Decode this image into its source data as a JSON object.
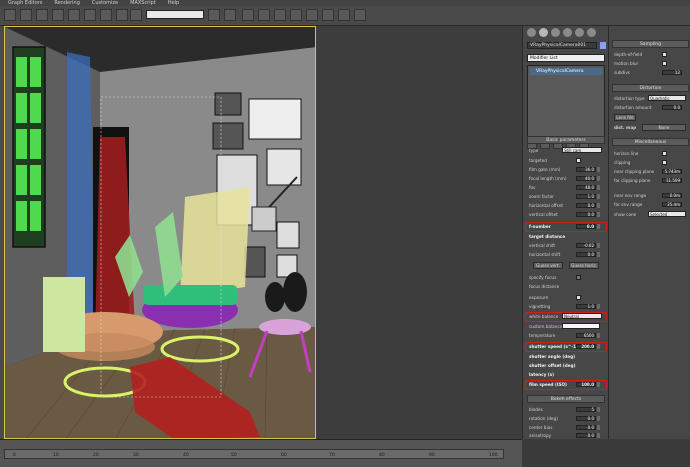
{
  "menu": [
    "Graph Editors",
    "Rendering",
    "Customize",
    "MAXScript",
    "Help"
  ],
  "toolbar": {
    "view_dropdown": ""
  },
  "command_panel": {
    "object_name": "VRayPhysicalCamera001",
    "modifier_list": "Modifier List",
    "stack_item": "VRayPhysicalCamera",
    "basic_parameters": {
      "title": "Basic parameters",
      "type_label": "type",
      "type_value": "Still cam",
      "targeted_label": "targeted",
      "film_gate_label": "film gate (mm)",
      "film_gate": "36.0",
      "focal_length_label": "focal length (mm)",
      "focal_length": "40.0",
      "fov_label": "fov",
      "fov": "48.0",
      "zoom_factor_label": "zoom factor",
      "zoom_factor": "1.0",
      "horizontal_offset_label": "horizontal offset",
      "horizontal_offset": "0.0",
      "vertical_offset_label": "vertical offset",
      "vertical_offset": "0.0",
      "fnumber_label": "f-number",
      "fnumber": "8.0",
      "target_distance_label": "target distance",
      "vertical_shift_label": "vertical shift",
      "vertical_shift": "-0.02",
      "horizontal_shift_label": "horizontal shift",
      "horizontal_shift": "0.0",
      "guess_vert": "Guess vert.",
      "guess_horiz": "Guess horiz.",
      "specify_focus_label": "specify focus",
      "focus_distance_label": "focus distance",
      "exposure_label": "exposure",
      "vignetting_label": "vignetting",
      "vignetting": "1.0",
      "white_balance_label": "white balance",
      "white_balance": "Neutral",
      "custom_balance_label": "custom balance",
      "temperature_label": "temperature",
      "temperature": "6500",
      "shutter_speed_label": "shutter speed (s^-1)",
      "shutter_speed": "200.0",
      "shutter_angle_label": "shutter angle (deg)",
      "shutter_angle": "180.0",
      "shutter_offset_label": "shutter offset (deg)",
      "shutter_offset": "0.0",
      "latency_label": "latency (s)",
      "latency": "0.0",
      "film_speed_label": "film speed (ISO)",
      "film_speed": "100.0"
    },
    "bokeh": {
      "title": "Bokeh effects",
      "blades_label": "blades",
      "blades": "5",
      "rotation_label": "rotation (deg)",
      "rotation": "0.0",
      "center_bias_label": "center bias",
      "center_bias": "0.0",
      "anisotropy_label": "anisotropy",
      "anisotropy": "0.0"
    }
  },
  "right_panel": {
    "sampling": {
      "title": "Sampling",
      "dof_label": "depth-of-field",
      "motion_blur_label": "motion blur",
      "subdivs_label": "subdivs",
      "subdivs": "12"
    },
    "distortion": {
      "title": "Distortion",
      "type_label": "distortion type",
      "type_value": "Quadratic",
      "amount_label": "distortion amount",
      "amount": "0.0",
      "lens_file": "Lens file",
      "dist_map_label": "dist. map",
      "dist_map_value": "None"
    },
    "misc": {
      "title": "Miscellaneous",
      "horizon_label": "horizon line",
      "clipping_label": "clipping",
      "near_clip_label": "near clipping plane",
      "near_clip": "5.743m",
      "far_clip_label": "far clipping plane",
      "far_clip": "11.509",
      "near_env_label": "near env range",
      "near_env": "0.0m",
      "far_env_label": "far env range",
      "far_env": "25.4m",
      "show_cone_label": "show cone",
      "show_cone": "Selected"
    }
  },
  "timeline": {
    "ticks": [
      "0",
      "10",
      "20",
      "30",
      "40",
      "50",
      "60",
      "70",
      "80",
      "90",
      "100"
    ]
  },
  "colors": {
    "highlight": "#d21c1c",
    "viewport_border": "#d8c24a"
  }
}
